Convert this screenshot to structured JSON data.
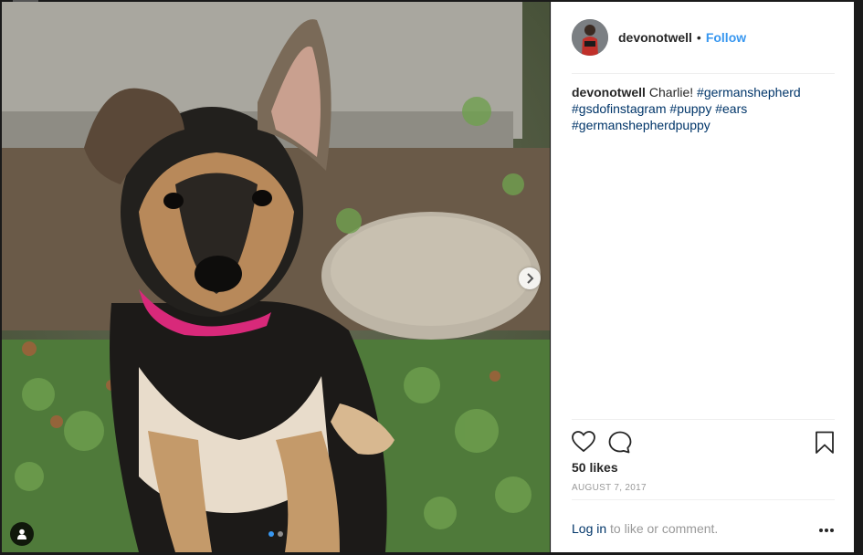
{
  "post": {
    "username": "devonotwell",
    "separator": "•",
    "follow_label": "Follow",
    "caption": {
      "username": "devonotwell",
      "text": "Charlie!",
      "hashtags": [
        "#germanshepherd",
        "#gsdofinstagram",
        "#puppy",
        "#ears",
        "#germanshepherdpuppy"
      ]
    },
    "likes": "50 likes",
    "date": "AUGUST 7, 2017",
    "login": {
      "link": "Log in",
      "rest": " to like or comment."
    },
    "more_label": "•••"
  },
  "media": {
    "carousel_dots": 2,
    "active_dot": 0
  },
  "icons": {
    "like": "heart-icon",
    "comment": "comment-icon",
    "save": "bookmark-icon",
    "next": "chevron-right-icon",
    "tag": "person-icon"
  },
  "colors": {
    "link": "#003569",
    "follow": "#3897f0",
    "text": "#262626",
    "muted": "#999999"
  }
}
